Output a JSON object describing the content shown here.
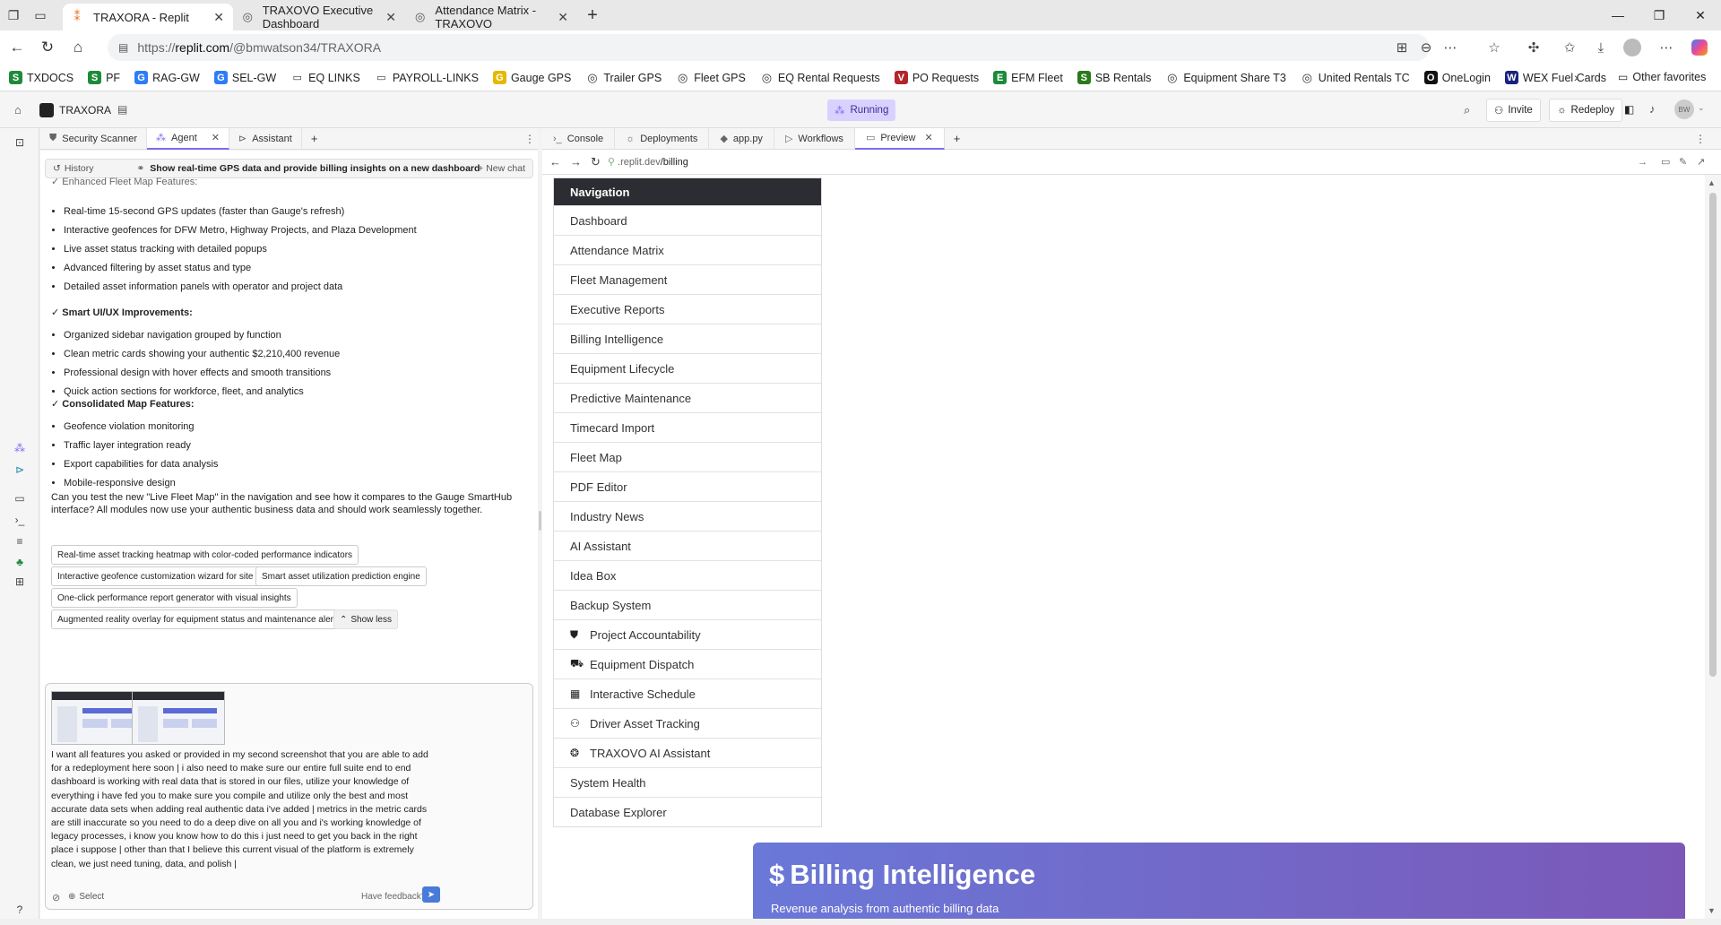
{
  "browser": {
    "tabs": [
      {
        "title": "TRAXORA - Replit",
        "active": true
      },
      {
        "title": "TRAXOVO Executive Dashboard",
        "active": false
      },
      {
        "title": "Attendance Matrix - TRAXOVO",
        "active": false
      }
    ],
    "url_prefix": "https://",
    "url_domain": "replit.com",
    "url_path": "/@bmwatson34/TRAXORA",
    "bookmarks": [
      {
        "label": "TXDOCS",
        "icon": "S",
        "color": "#1f8a3a"
      },
      {
        "label": "PF",
        "icon": "S",
        "color": "#1f8a3a"
      },
      {
        "label": "RAG-GW",
        "icon": "G",
        "color": "#2e7cf6"
      },
      {
        "label": "SEL-GW",
        "icon": "G",
        "color": "#2e7cf6"
      },
      {
        "label": "EQ LINKS",
        "icon": "folder",
        "color": ""
      },
      {
        "label": "PAYROLL-LINKS",
        "icon": "folder",
        "color": ""
      },
      {
        "label": "Gauge GPS",
        "icon": "G",
        "color": "#e6b800"
      },
      {
        "label": "Trailer GPS",
        "icon": "globe",
        "color": ""
      },
      {
        "label": "Fleet GPS",
        "icon": "globe",
        "color": ""
      },
      {
        "label": "EQ Rental Requests",
        "icon": "globe",
        "color": ""
      },
      {
        "label": "PO Requests",
        "icon": "V",
        "color": "#b3242b"
      },
      {
        "label": "EFM Fleet",
        "icon": "E",
        "color": "#1b8a3a"
      },
      {
        "label": "SB Rentals",
        "icon": "S",
        "color": "#2a7a1a"
      },
      {
        "label": "Equipment Share T3",
        "icon": "globe",
        "color": ""
      },
      {
        "label": "United Rentals TC",
        "icon": "globe",
        "color": ""
      },
      {
        "label": "OneLogin",
        "icon": "O",
        "color": "#111"
      },
      {
        "label": "WEX Fuel Cards",
        "icon": "W",
        "color": "#1a237e"
      }
    ],
    "other_favorites": "Other favorites"
  },
  "replit": {
    "project_name": "TRAXORA",
    "status": "Running",
    "invite_label": "Invite",
    "redeploy_label": "Redeploy",
    "avatar_initials": "BW"
  },
  "left_tabs": [
    {
      "label": "Security Scanner",
      "icon": "shield-icon",
      "active": false
    },
    {
      "label": "Agent",
      "icon": "agent-icon",
      "active": true
    },
    {
      "label": "Assistant",
      "icon": "assistant-icon",
      "active": false
    }
  ],
  "history_bar": {
    "history_label": "History",
    "thread_title": "Show real-time GPS data and provide billing insights on a new dashboard",
    "new_chat_label": "+ New chat"
  },
  "chat": {
    "cut_heading": "✓ Enhanced Fleet Map Features:",
    "section1_items": [
      "Real-time 15-second GPS updates (faster than Gauge's refresh)",
      "Interactive geofences for DFW Metro, Highway Projects, and Plaza Development",
      "Live asset status tracking with detailed popups",
      "Advanced filtering by asset status and type",
      "Detailed asset information panels with operator and project data"
    ],
    "section2_heading": "Smart UI/UX Improvements:",
    "section2_items": [
      "Organized sidebar navigation grouped by function",
      "Clean metric cards showing your authentic $2,210,400 revenue",
      "Professional design with hover effects and smooth transitions",
      "Quick action sections for workforce, fleet, and analytics"
    ],
    "section3_heading": "Consolidated Map Features:",
    "section3_items": [
      "Geofence violation monitoring",
      "Traffic layer integration ready",
      "Export capabilities for data analysis",
      "Mobile-responsive design"
    ],
    "question": "Can you test the new \"Live Fleet Map\" in the navigation and see how it compares to the Gauge SmartHub interface? All modules now use your authentic business data and should work seamlessly together.",
    "suggestions": [
      "Real-time asset tracking heatmap with color-coded performance indicators",
      "Interactive geofence customization wizard for site managers",
      "Smart asset utilization prediction engine",
      "One-click performance report generator with visual insights",
      "Augmented reality overlay for equipment status and maintenance alerts"
    ],
    "show_less": "Show less"
  },
  "composer": {
    "message": "I want all features you asked or provided in my second screenshot that you are able to add for a redeployment here soon | i also need to make sure our entire full suite end to end dashboard is working with real data that is stored in our files, utilize your knowledge of everything i have fed you to make sure you compile and utilize only the best and most accurate data sets when adding real authentic data i've added | metrics in the metric cards are still inaccurate so you need to do a deep dive on all you and i's working knowledge of legacy processes, i know you know how to do this i just need to get you back in the right place i suppose | other than that I believe this current visual of the platform is extremely clean, we just need tuning, data, and polish |",
    "select_label": "Select",
    "feedback_label": "Have feedback?"
  },
  "right_tabs": [
    {
      "label": "Console",
      "icon": "console-icon",
      "active": false
    },
    {
      "label": "Deployments",
      "icon": "deploy-icon",
      "active": false
    },
    {
      "label": "app.py",
      "icon": "python-icon",
      "active": false
    },
    {
      "label": "Workflows",
      "icon": "workflow-icon",
      "active": false
    },
    {
      "label": "Preview",
      "icon": "preview-icon",
      "active": true
    }
  ],
  "preview_url": {
    "domain": ".replit.dev",
    "path": "/billing"
  },
  "navigation": {
    "header": "Navigation",
    "items": [
      {
        "label": "Dashboard",
        "icon": ""
      },
      {
        "label": "Attendance Matrix",
        "icon": ""
      },
      {
        "label": "Fleet Management",
        "icon": ""
      },
      {
        "label": "Executive Reports",
        "icon": ""
      },
      {
        "label": "Billing Intelligence",
        "icon": ""
      },
      {
        "label": "Equipment Lifecycle",
        "icon": ""
      },
      {
        "label": "Predictive Maintenance",
        "icon": ""
      },
      {
        "label": "Timecard Import",
        "icon": ""
      },
      {
        "label": "Fleet Map",
        "icon": ""
      },
      {
        "label": "PDF Editor",
        "icon": ""
      },
      {
        "label": "Industry News",
        "icon": ""
      },
      {
        "label": "AI Assistant",
        "icon": ""
      },
      {
        "label": "Idea Box",
        "icon": ""
      },
      {
        "label": "Backup System",
        "icon": ""
      },
      {
        "label": "Project Accountability",
        "icon": "shield-icon"
      },
      {
        "label": "Equipment Dispatch",
        "icon": "truck-icon"
      },
      {
        "label": "Interactive Schedule",
        "icon": "calendar-icon"
      },
      {
        "label": "Driver Asset Tracking",
        "icon": "users-icon"
      },
      {
        "label": "TRAXOVO AI Assistant",
        "icon": "brain-icon"
      },
      {
        "label": "System Health",
        "icon": ""
      },
      {
        "label": "Database Explorer",
        "icon": ""
      }
    ]
  },
  "billing_banner": {
    "title": "Billing Intelligence",
    "subtitle": "Revenue analysis from authentic billing data"
  }
}
